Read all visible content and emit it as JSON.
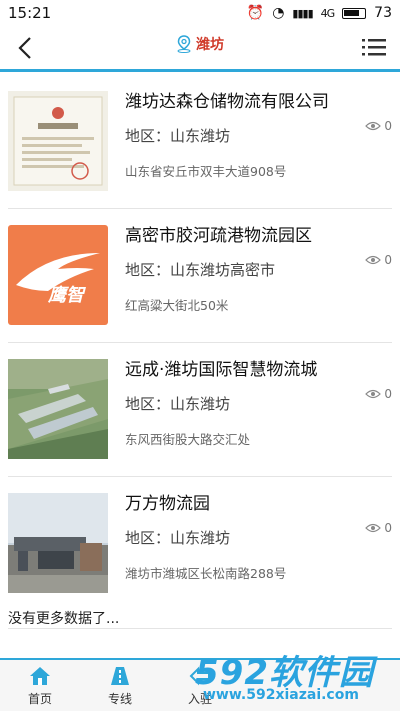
{
  "status_bar": {
    "time": "15:21",
    "battery": "73",
    "network_label": "4G"
  },
  "nav": {
    "title": "潍坊",
    "back_icon": "back-arrow-icon",
    "menu_icon": "list-menu-icon"
  },
  "items": [
    {
      "name": "潍坊达森仓储物流有限公司",
      "region": "地区：山东潍坊",
      "address": "山东省安丘市双丰大道908号",
      "views": "0",
      "thumb": "business-license"
    },
    {
      "name": "高密市胶河疏港物流园区",
      "region": "地区：山东潍坊高密市",
      "address": "红高粱大街北50米",
      "views": "0",
      "thumb": "eagle-logo",
      "logo_text": "鹰智"
    },
    {
      "name": "远成·潍坊国际智慧物流城",
      "region": "地区：山东潍坊",
      "address": "东风西街股大路交汇处",
      "views": "0",
      "thumb": "aerial-view"
    },
    {
      "name": "万方物流园",
      "region": "地区：山东潍坊",
      "address": "潍坊市潍城区长松南路288号",
      "views": "0",
      "thumb": "gate-photo"
    }
  ],
  "no_more_text": "没有更多数据了...",
  "tabs": [
    {
      "label": "首页",
      "icon": "home-icon"
    },
    {
      "label": "专线",
      "icon": "road-icon"
    },
    {
      "label": "入驻",
      "icon": "enter-icon"
    }
  ],
  "watermark": {
    "big": "592软件园",
    "small": "www.592xiazai.com"
  },
  "colors": {
    "accent": "#2ea7d9",
    "title": "#d03a2a",
    "logo_bg": "#f07d4a"
  }
}
